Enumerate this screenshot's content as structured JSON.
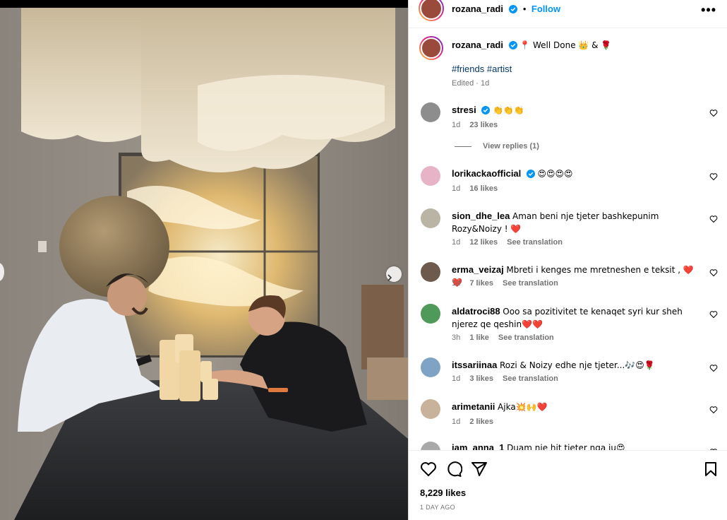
{
  "post": {
    "author": "rozana_radi",
    "follow_label": "Follow",
    "more_label": "•••",
    "caption": "📍 Well Done 👑 & 🌹",
    "hashtags": "#friends #artist",
    "edited": "Edited · 1d"
  },
  "comments": [
    {
      "user": "stresi",
      "verified": true,
      "text": "👏👏👏",
      "time": "1d",
      "likes": "23 likes",
      "translate": "",
      "replies": "View replies (1)"
    },
    {
      "user": "lorikackaofficial",
      "verified": true,
      "text": "😍😍😍😍",
      "time": "1d",
      "likes": "16 likes",
      "translate": "",
      "replies": ""
    },
    {
      "user": "sion_dhe_lea",
      "verified": false,
      "text": "Aman beni nje tjeter bashkepunim Rozy&Noizy ! ❤️",
      "time": "1d",
      "likes": "12 likes",
      "translate": "See translation",
      "replies": ""
    },
    {
      "user": "erma_veizaj",
      "verified": false,
      "text": "Mbreti i kenges me mretneshen e teksit , ❤️❤️",
      "time": "1d",
      "likes": "7 likes",
      "translate": "See translation",
      "replies": ""
    },
    {
      "user": "aldatroci88",
      "verified": false,
      "text": "Ooo sa pozitivitet te kenaqet syri kur sheh njerez qe qeshin❤️❤️",
      "time": "3h",
      "likes": "1 like",
      "translate": "See translation",
      "replies": ""
    },
    {
      "user": "itssariinaa",
      "verified": false,
      "text": "Rozi & Noizy edhe nje tjeter...🎶😍🌹",
      "time": "1d",
      "likes": "3 likes",
      "translate": "See translation",
      "replies": ""
    },
    {
      "user": "arimetanii",
      "verified": false,
      "text": "Ajka💥🙌❤️",
      "time": "1d",
      "likes": "2 likes",
      "translate": "",
      "replies": ""
    },
    {
      "user": "iam_anna_1",
      "verified": false,
      "text": "Duam nje hit tjeter nga ju😍",
      "time": "",
      "likes": "",
      "translate": "",
      "replies": ""
    }
  ],
  "footer": {
    "likes": "8,229 likes",
    "time_ago": "1 DAY AGO"
  },
  "colors": {
    "link": "#0095f6",
    "hashtag": "#00376b",
    "muted": "#737373",
    "verified": "#0095f6"
  },
  "icons": [
    "heart-icon",
    "comment-icon",
    "share-icon",
    "bookmark-icon",
    "verified-icon",
    "more-icon",
    "chevron-right-icon"
  ]
}
